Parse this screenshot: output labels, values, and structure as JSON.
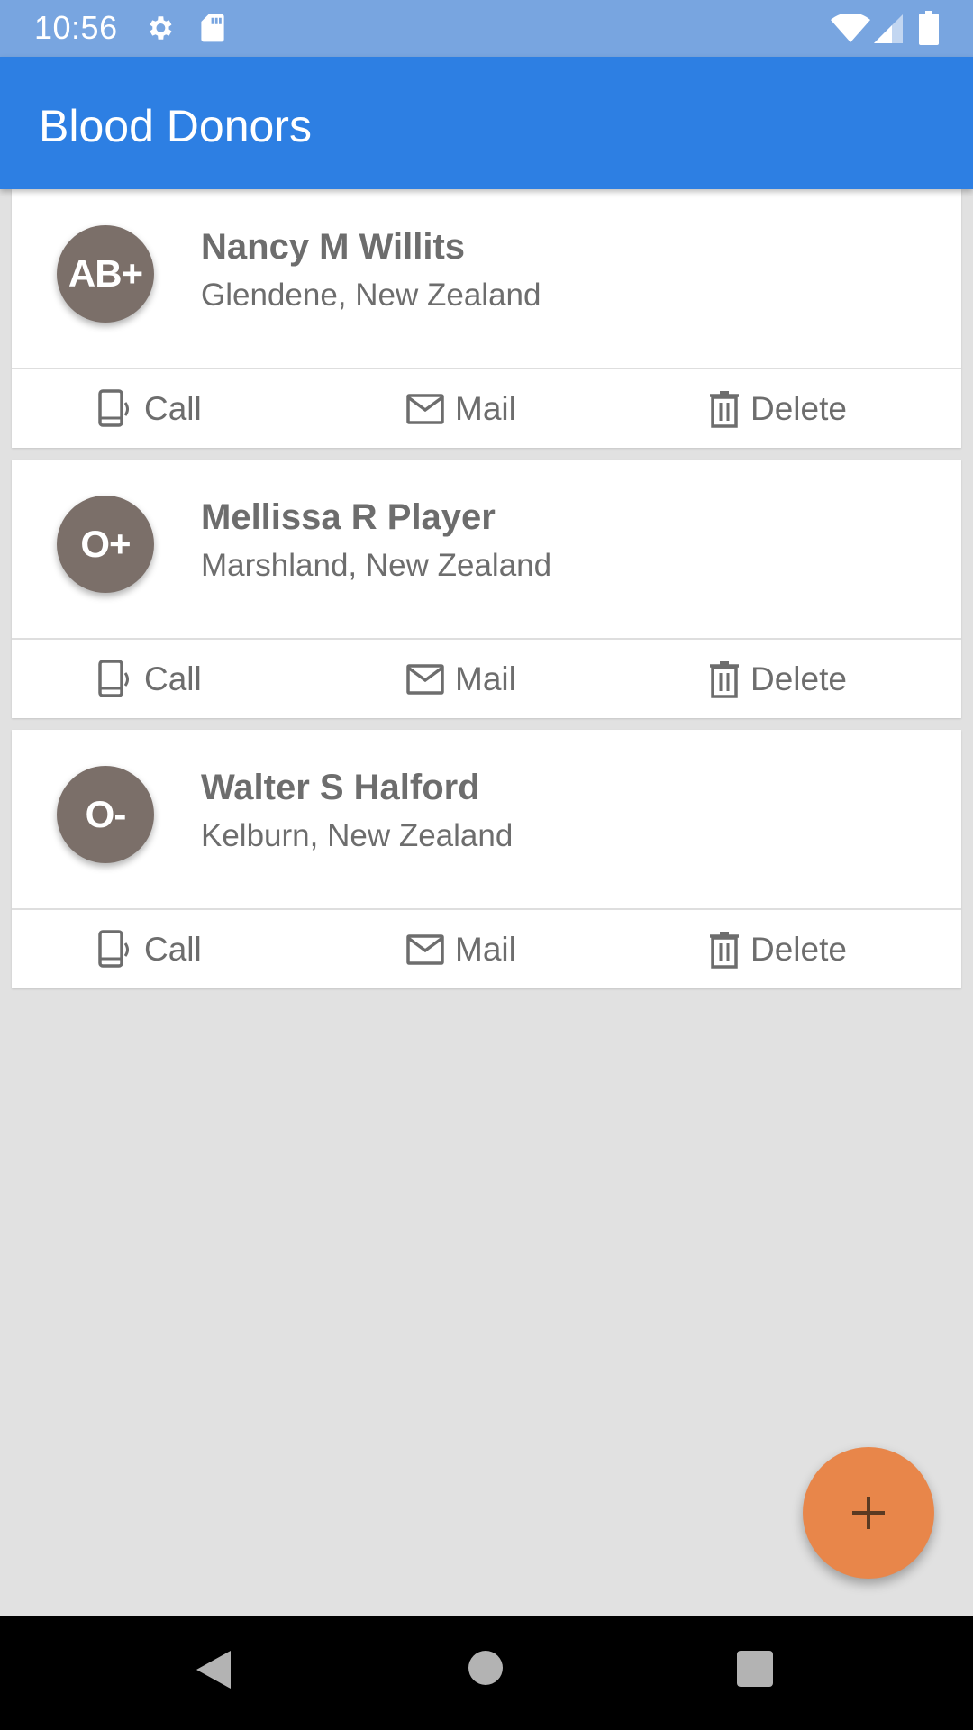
{
  "status_bar": {
    "time": "10:56",
    "icons": [
      "gear-icon",
      "sd-card-icon",
      "wifi-icon",
      "signal-icon",
      "battery-icon"
    ]
  },
  "app_bar": {
    "title": "Blood Donors",
    "color": "#2d7fe3"
  },
  "donors": [
    {
      "blood_type": "AB+",
      "name": "Nancy M Willits",
      "location": "Glendene, New Zealand"
    },
    {
      "blood_type": "O+",
      "name": "Mellissa R Player",
      "location": "Marshland, New Zealand"
    },
    {
      "blood_type": "O-",
      "name": "Walter S Halford",
      "location": "Kelburn, New Zealand"
    }
  ],
  "actions": {
    "call": "Call",
    "mail": "Mail",
    "delete": "Delete"
  },
  "fab": {
    "icon": "plus-icon",
    "color": "#e8864a"
  },
  "nav_bar": {
    "icons": [
      "back-icon",
      "home-icon",
      "recents-icon"
    ]
  }
}
